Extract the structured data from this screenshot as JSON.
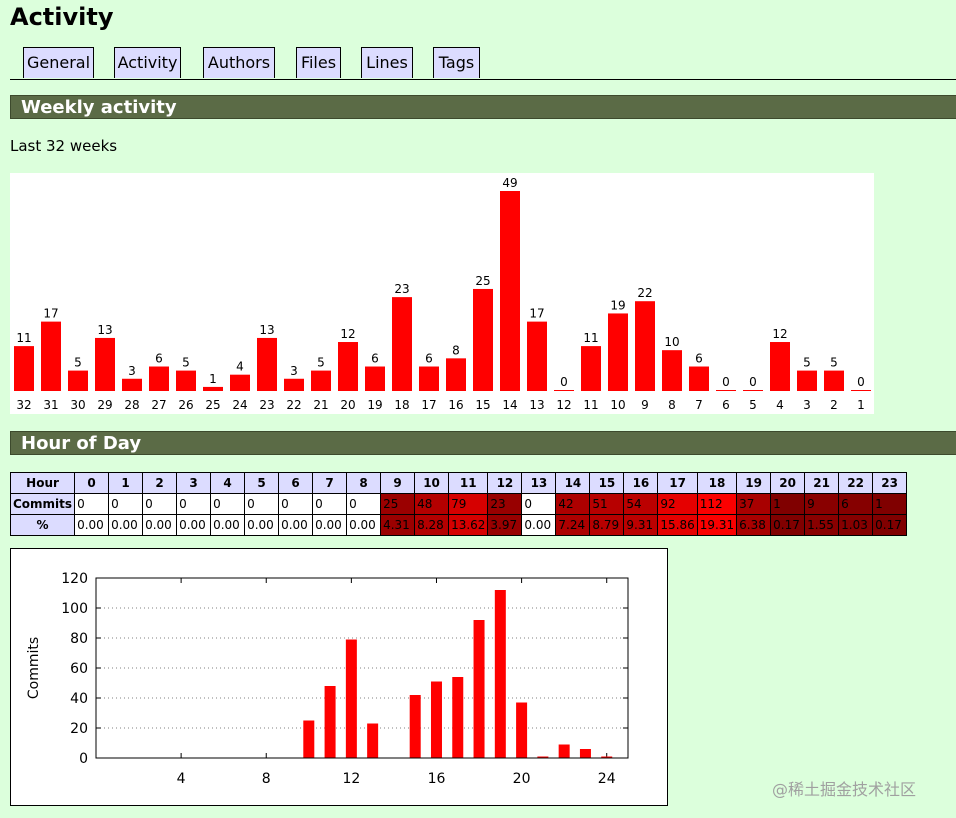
{
  "page": {
    "title": "Activity"
  },
  "nav": {
    "tabs": [
      "General",
      "Activity",
      "Authors",
      "Files",
      "Lines",
      "Tags"
    ]
  },
  "weekly": {
    "heading": "Weekly activity",
    "subtitle": "Last 32 weeks"
  },
  "hour_of_day": {
    "heading": "Hour of Day",
    "row_labels": {
      "hour": "Hour",
      "commits": "Commits",
      "percent": "%"
    },
    "hours": [
      "0",
      "1",
      "2",
      "3",
      "4",
      "5",
      "6",
      "7",
      "8",
      "9",
      "10",
      "11",
      "12",
      "13",
      "14",
      "15",
      "16",
      "17",
      "18",
      "19",
      "20",
      "21",
      "22",
      "23"
    ],
    "commits": [
      "0",
      "0",
      "0",
      "0",
      "0",
      "0",
      "0",
      "0",
      "0",
      "25",
      "48",
      "79",
      "23",
      "0",
      "42",
      "51",
      "54",
      "92",
      "112",
      "37",
      "1",
      "9",
      "6",
      "1"
    ],
    "percent": [
      "0.00",
      "0.00",
      "0.00",
      "0.00",
      "0.00",
      "0.00",
      "0.00",
      "0.00",
      "0.00",
      "4.31",
      "8.28",
      "13.62",
      "3.97",
      "0.00",
      "7.24",
      "8.79",
      "9.31",
      "15.86",
      "19.31",
      "6.38",
      "0.17",
      "1.55",
      "1.03",
      "0.17"
    ]
  },
  "chart_data": [
    {
      "type": "bar",
      "categories": [
        "32",
        "31",
        "30",
        "29",
        "28",
        "27",
        "26",
        "25",
        "24",
        "23",
        "22",
        "21",
        "20",
        "19",
        "18",
        "17",
        "16",
        "15",
        "14",
        "13",
        "12",
        "11",
        "10",
        "9",
        "8",
        "7",
        "6",
        "5",
        "4",
        "3",
        "2",
        "1"
      ],
      "values": [
        11,
        17,
        5,
        13,
        3,
        6,
        5,
        1,
        4,
        13,
        3,
        5,
        12,
        6,
        23,
        6,
        8,
        25,
        49,
        17,
        0,
        11,
        19,
        22,
        10,
        6,
        0,
        0,
        12,
        5,
        5,
        0
      ],
      "color": "#ff0000"
    },
    {
      "type": "bar",
      "x": [
        10,
        11,
        12,
        13,
        14,
        15,
        16,
        17,
        18,
        19,
        20,
        21,
        22,
        23,
        24
      ],
      "values": [
        25,
        48,
        79,
        23,
        0,
        42,
        51,
        54,
        92,
        112,
        37,
        1,
        9,
        6,
        1
      ],
      "ylabel": "Commits",
      "xlim": [
        0,
        25
      ],
      "ylim": [
        0,
        120
      ],
      "xticks": [
        "4",
        "8",
        "12",
        "16",
        "20",
        "24"
      ],
      "yticks": [
        "0",
        "20",
        "40",
        "60",
        "80",
        "100",
        "120"
      ],
      "grid": true,
      "color": "#ff0000"
    }
  ]
}
